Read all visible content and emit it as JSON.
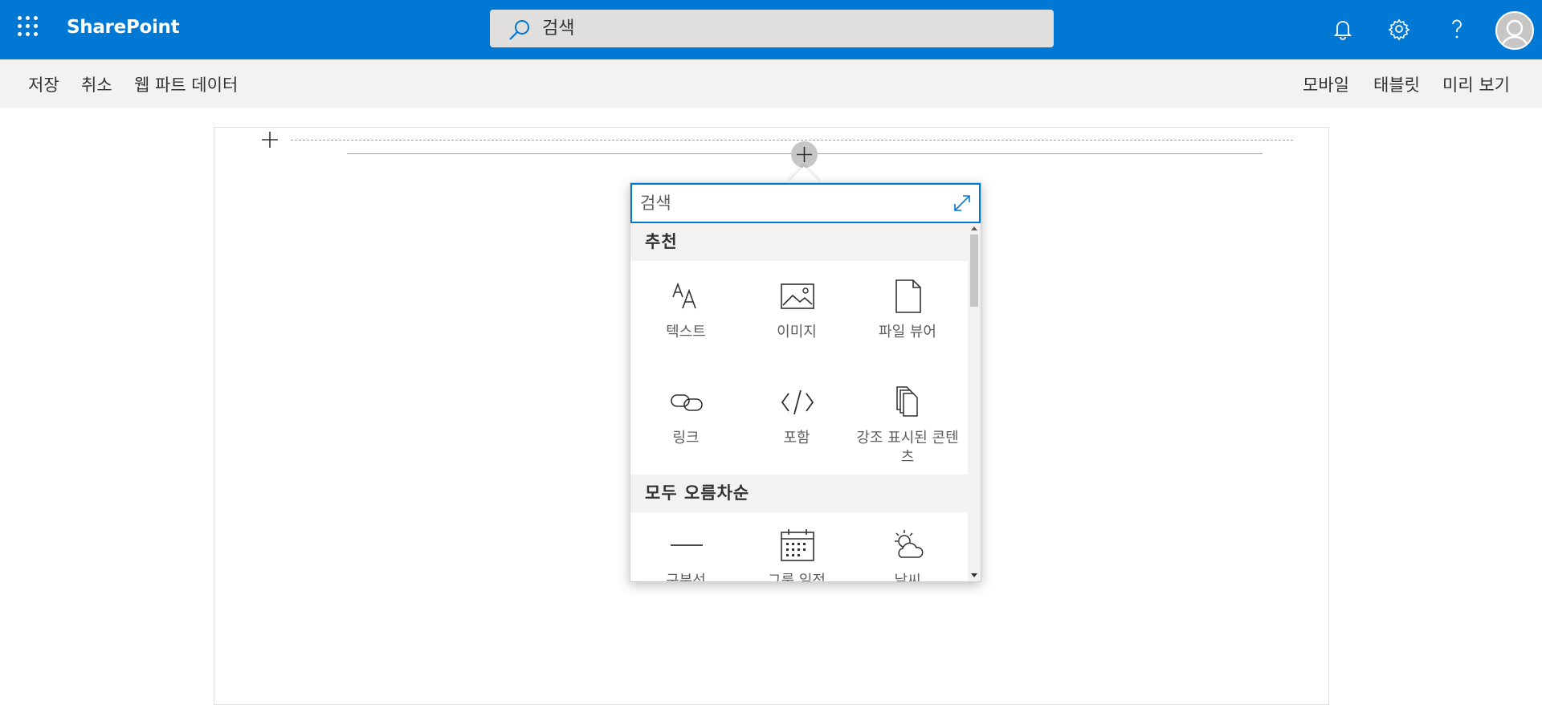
{
  "suitebar": {
    "brand": "SharePoint",
    "search_placeholder": "검색"
  },
  "commandbar": {
    "left": [
      "저장",
      "취소",
      "웹 파트 데이터"
    ],
    "right": [
      "모바일",
      "태블릿",
      "미리 보기"
    ]
  },
  "toolbox": {
    "search_placeholder": "검색",
    "categories": [
      {
        "label": "추천"
      },
      {
        "label": "모두 오름차순"
      }
    ],
    "recommended": [
      {
        "label": "텍스트",
        "icon": "text-icon"
      },
      {
        "label": "이미지",
        "icon": "image-icon"
      },
      {
        "label": "파일 뷰어",
        "icon": "file-icon"
      },
      {
        "label": "링크",
        "icon": "link-icon"
      },
      {
        "label": "포함",
        "icon": "embed-code-icon"
      },
      {
        "label": "강조 표시된 콘텐츠",
        "icon": "highlighted-content-icon"
      }
    ],
    "all": [
      {
        "label": "구분선",
        "icon": "divider-icon"
      },
      {
        "label": "그룹 일정",
        "icon": "calendar-icon"
      },
      {
        "label": "날씨",
        "icon": "weather-icon"
      }
    ]
  },
  "colors": {
    "brand_blue": "#0078d4",
    "command_bg": "#f3f2f1"
  }
}
